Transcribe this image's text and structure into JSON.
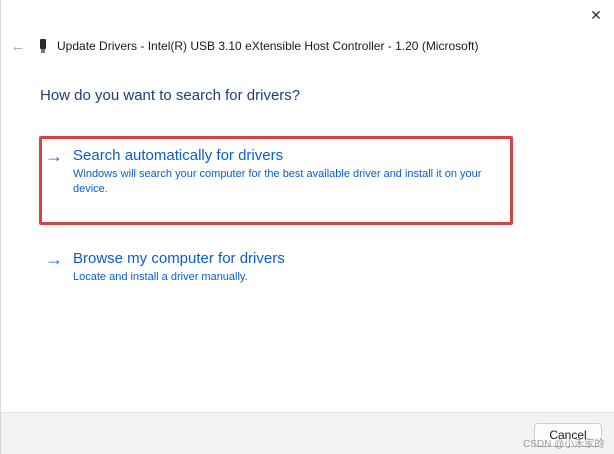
{
  "window": {
    "title": "Update Drivers - Intel(R) USB 3.10 eXtensible Host Controller - 1.20 (Microsoft)",
    "close_glyph": "✕",
    "back_glyph": "←"
  },
  "main": {
    "question": "How do you want to search for drivers?",
    "options": [
      {
        "title": "Search automatically for drivers",
        "description": "Windows will search your computer for the best available driver and install it on your device."
      },
      {
        "title": "Browse my computer for drivers",
        "description": "Locate and install a driver manually."
      }
    ],
    "arrow_glyph": "→"
  },
  "footer": {
    "cancel_label": "Cancel"
  },
  "watermark": {
    "text": "CSDN @小禾家的"
  },
  "colors": {
    "accent": "#0b5ec9",
    "heading": "#1f3e72",
    "highlight": "#d64545"
  }
}
